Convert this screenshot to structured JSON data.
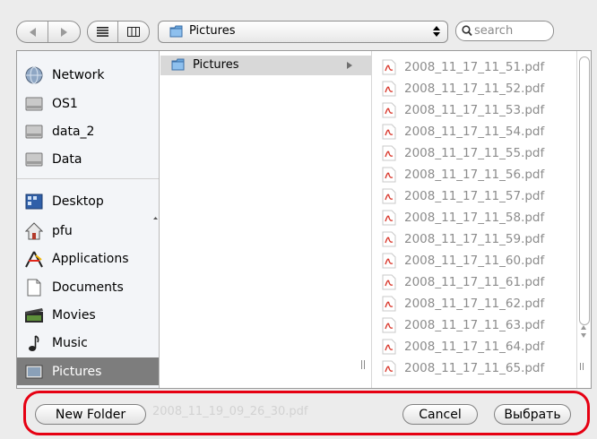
{
  "toolbar": {
    "back_icon": "back-arrow-icon",
    "forward_icon": "forward-arrow-icon",
    "list_view_icon": "list-view-icon",
    "column_view_icon": "column-view-icon",
    "path": "Pictures",
    "search_placeholder": "search"
  },
  "sidebar": {
    "items": [
      {
        "label": "Network",
        "icon": "network-globe-icon"
      },
      {
        "label": "OS1",
        "icon": "hard-drive-icon"
      },
      {
        "label": "data_2",
        "icon": "hard-drive-icon"
      },
      {
        "label": "Data",
        "icon": "hard-drive-icon"
      },
      {
        "label": "Desktop",
        "icon": "desktop-icon"
      },
      {
        "label": "pfu",
        "icon": "home-icon"
      },
      {
        "label": "Applications",
        "icon": "applications-icon"
      },
      {
        "label": "Documents",
        "icon": "documents-icon"
      },
      {
        "label": "Movies",
        "icon": "movies-icon"
      },
      {
        "label": "Music",
        "icon": "music-icon"
      },
      {
        "label": "Pictures",
        "icon": "pictures-icon",
        "selected": true
      }
    ]
  },
  "column1": {
    "folder": "Pictures"
  },
  "files": [
    "2008_11_17_11_51.pdf",
    "2008_11_17_11_52.pdf",
    "2008_11_17_11_53.pdf",
    "2008_11_17_11_54.pdf",
    "2008_11_17_11_55.pdf",
    "2008_11_17_11_56.pdf",
    "2008_11_17_11_57.pdf",
    "2008_11_17_11_58.pdf",
    "2008_11_17_11_59.pdf",
    "2008_11_17_11_60.pdf",
    "2008_11_17_11_61.pdf",
    "2008_11_17_11_62.pdf",
    "2008_11_17_11_63.pdf",
    "2008_11_17_11_64.pdf",
    "2008_11_17_11_65.pdf"
  ],
  "footer": {
    "new_folder": "New Folder",
    "background_filename": "2008_11_19_09_26_30.pdf",
    "cancel": "Cancel",
    "choose": "Выбрать"
  },
  "colors": {
    "highlight_border": "#e60012",
    "sidebar_selected": "#7d7d7d",
    "folder_blue": "#5b9bd5",
    "pdf_red": "#d9382c"
  }
}
